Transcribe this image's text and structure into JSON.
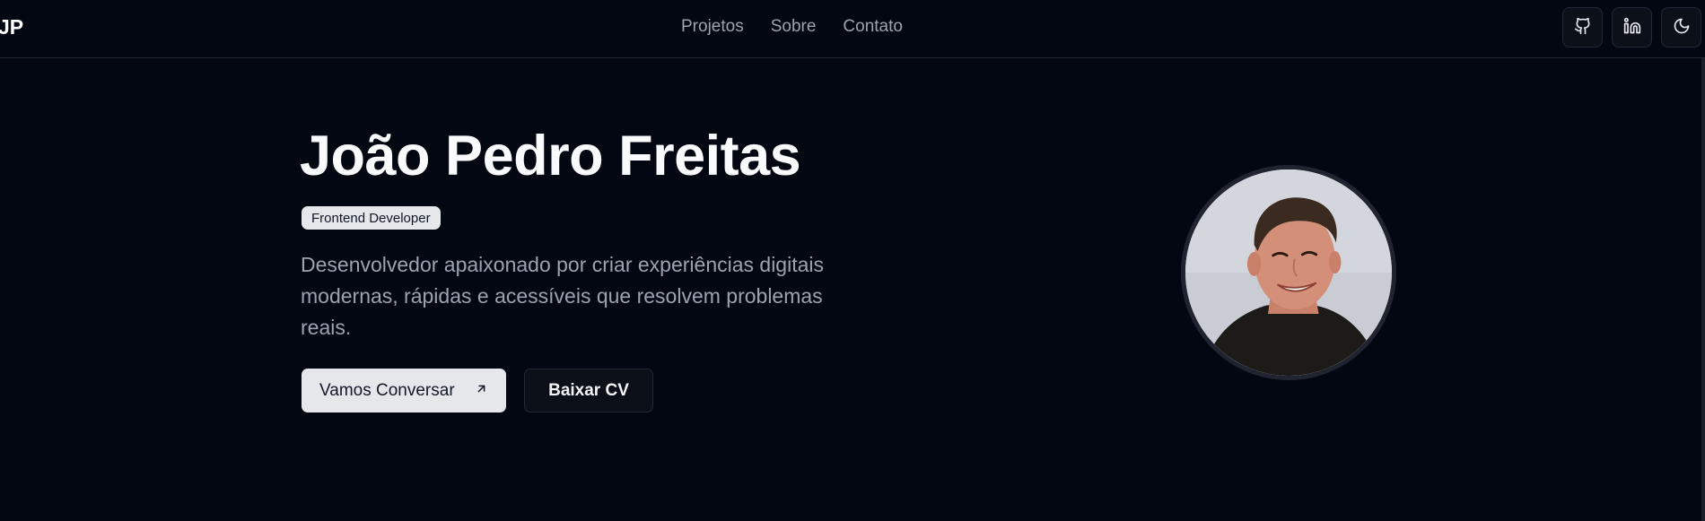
{
  "header": {
    "logo": "JP",
    "nav": [
      {
        "label": "Projetos"
      },
      {
        "label": "Sobre"
      },
      {
        "label": "Contato"
      }
    ],
    "actions": [
      {
        "icon": "github-icon"
      },
      {
        "icon": "linkedin-icon"
      },
      {
        "icon": "moon-icon"
      }
    ]
  },
  "hero": {
    "name": "João Pedro Freitas",
    "role": "Frontend Developer",
    "description": "Desenvolvedor apaixonado por criar experiências digitais modernas, rápidas e acessíveis que resolvem problemas reais.",
    "primary_button": "Vamos Conversar",
    "primary_button_icon": "arrow-up-right-icon",
    "secondary_button": "Baixar CV"
  },
  "colors": {
    "background": "#030712",
    "text": "#f9fafb",
    "muted": "#9ca3af",
    "button_light": "#e5e7eb",
    "border": "#1f2937"
  }
}
